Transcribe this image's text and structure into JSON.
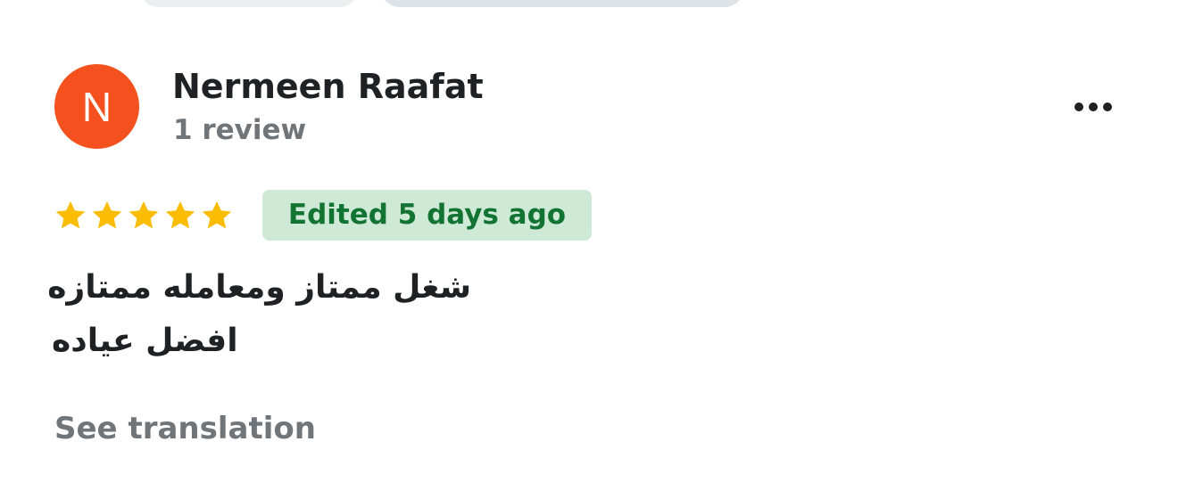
{
  "reviewer": {
    "avatar_initial": "N",
    "name": "Nermeen Raafat",
    "review_count": "1 review"
  },
  "review": {
    "rating": 5,
    "rating_max": 5,
    "edited_label": "Edited 5 days ago",
    "text_lines": [
      "شغل ممتاز ومعامله ممتازه",
      "افضل عياده"
    ],
    "see_translation_label": "See translation"
  },
  "icons": {
    "more": "more-horizontal-icon",
    "star": "star-icon"
  },
  "colors": {
    "avatar_bg": "#f4511e",
    "star_fill": "#fbbc04",
    "edited_badge_bg": "#ceead6",
    "edited_badge_text": "#137333",
    "secondary_text": "#70757a",
    "primary_text": "#202124"
  }
}
